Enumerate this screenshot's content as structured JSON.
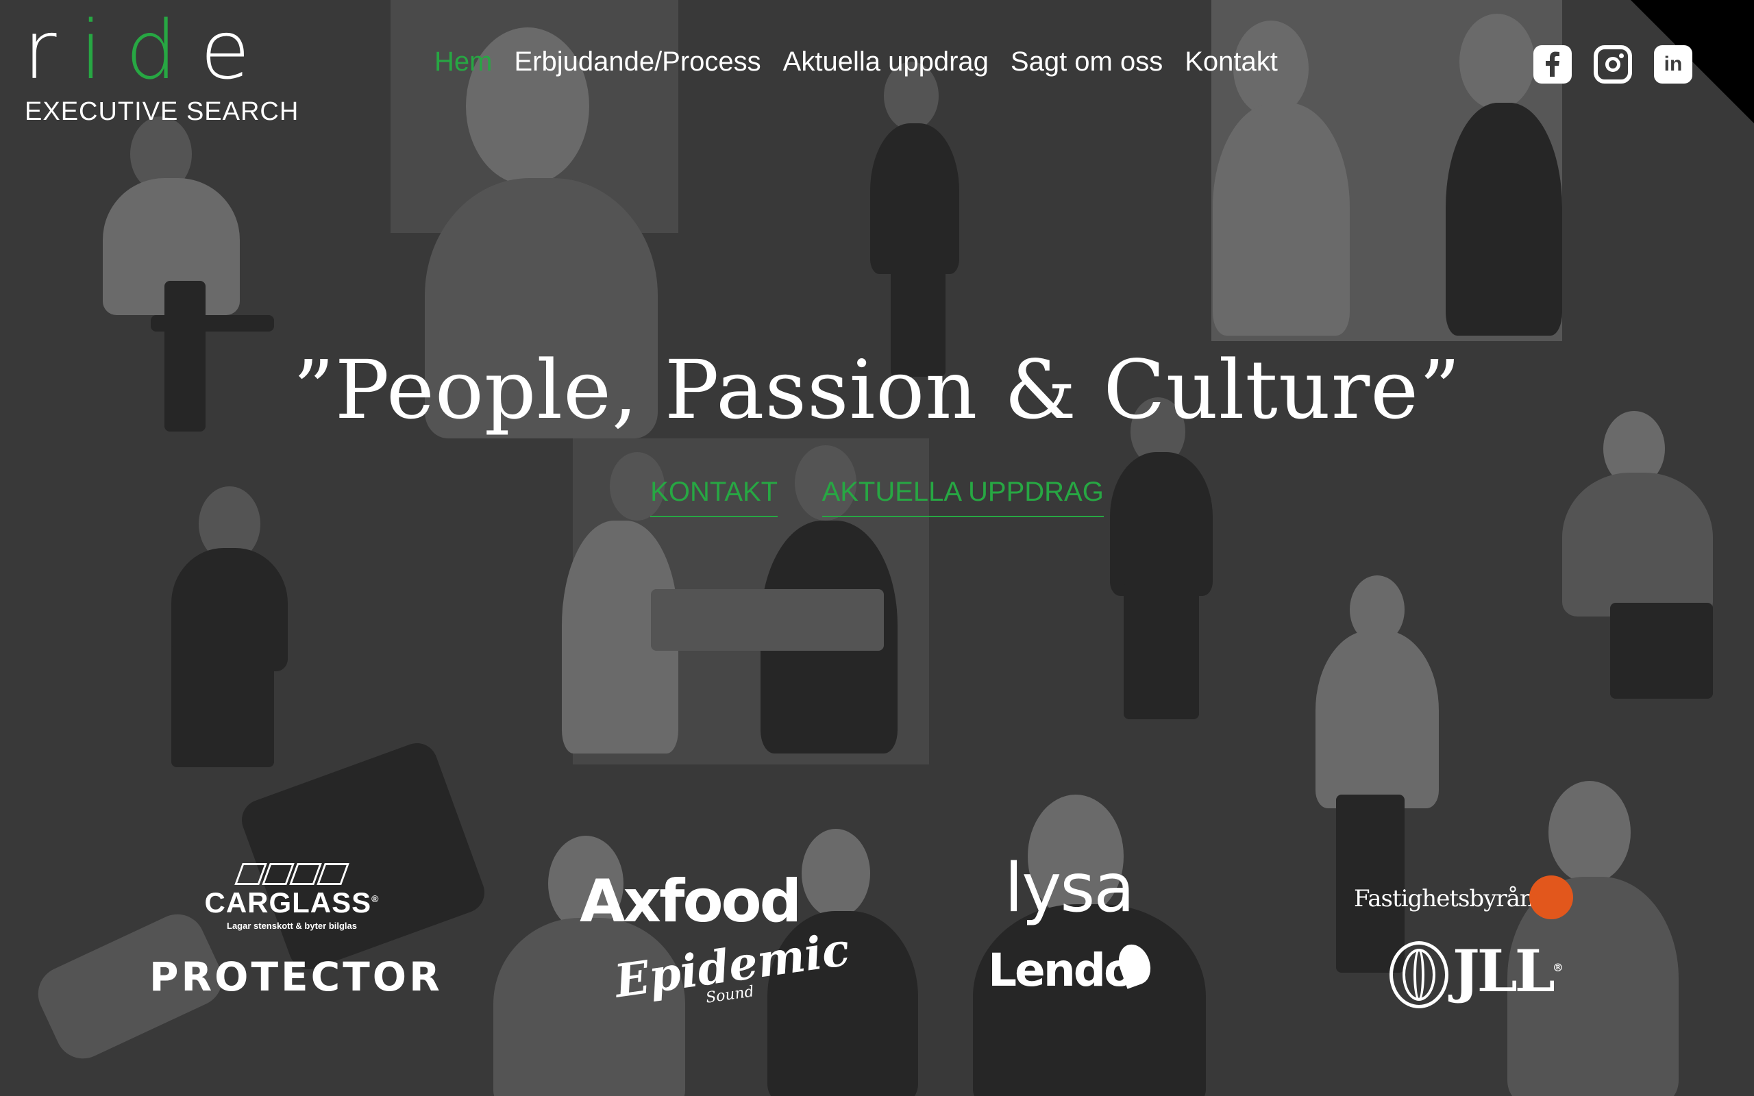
{
  "logo": {
    "letter_r": "r",
    "letter_id": "id",
    "letter_e": "e",
    "subtitle": "EXECUTIVE SEARCH"
  },
  "nav": {
    "items": [
      {
        "label": "Hem",
        "active": true
      },
      {
        "label": "Erbjudande/Process",
        "active": false
      },
      {
        "label": "Aktuella uppdrag",
        "active": false
      },
      {
        "label": "Sagt om oss",
        "active": false
      },
      {
        "label": "Kontakt",
        "active": false
      }
    ]
  },
  "social": [
    {
      "icon": "facebook-icon"
    },
    {
      "icon": "instagram-icon"
    },
    {
      "icon": "linkedin-icon",
      "glyph": "in"
    }
  ],
  "hero": {
    "title": "”People, Passion & Culture”",
    "cta_contact": "KONTAKT",
    "cta_assignments": "AKTUELLA UPPDRAG"
  },
  "clients": {
    "carglass": "CARGLASS",
    "carglass_tag": "Lagar stenskott & byter bilglas",
    "carglass_reg": "®",
    "protector": "PROTECTOR",
    "axfood": "Axfood",
    "epidemic": "Epidemic",
    "epidemic_sub": "Sound",
    "lysa": "lysa",
    "lendo": "Lendo",
    "fastighetsbyran": "Fastighetsbyrån",
    "jll": "JLL",
    "jll_reg": "®"
  },
  "colors": {
    "accent": "#27a743",
    "background": "#3a3a3a",
    "text": "#ffffff",
    "fastighetsbyran_badge": "#e2571c"
  }
}
